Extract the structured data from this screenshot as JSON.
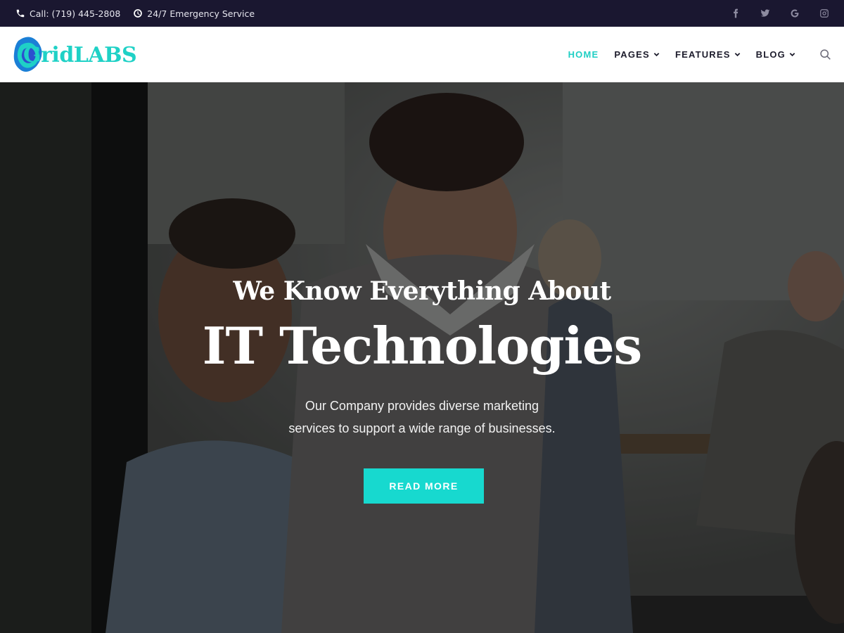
{
  "topbar": {
    "phone": "Call: (719) 445-2808",
    "service": "24/7 Emergency Service",
    "social": [
      {
        "icon": "facebook-icon",
        "glyph": "f"
      },
      {
        "icon": "twitter-icon",
        "glyph": "t"
      },
      {
        "icon": "google-icon",
        "glyph": "G"
      },
      {
        "icon": "instagram-icon",
        "glyph": "ig"
      }
    ]
  },
  "header": {
    "logo_text": "GridLABS",
    "nav": [
      {
        "label": "HOME",
        "active": true,
        "dropdown": false
      },
      {
        "label": "PAGES",
        "active": false,
        "dropdown": true
      },
      {
        "label": "FEATURES",
        "active": false,
        "dropdown": true
      },
      {
        "label": "BLOG",
        "active": false,
        "dropdown": true
      }
    ]
  },
  "hero": {
    "kicker": "We Know Everything About",
    "headline": "IT Technologies",
    "desc_line1": "Our Company provides diverse marketing",
    "desc_line2": "services to support a wide range of businesses.",
    "cta": "READ MORE"
  },
  "colors": {
    "accent": "#1fcfc4",
    "topbar_bg": "#1a1730",
    "button_bg": "#17d9cf"
  }
}
